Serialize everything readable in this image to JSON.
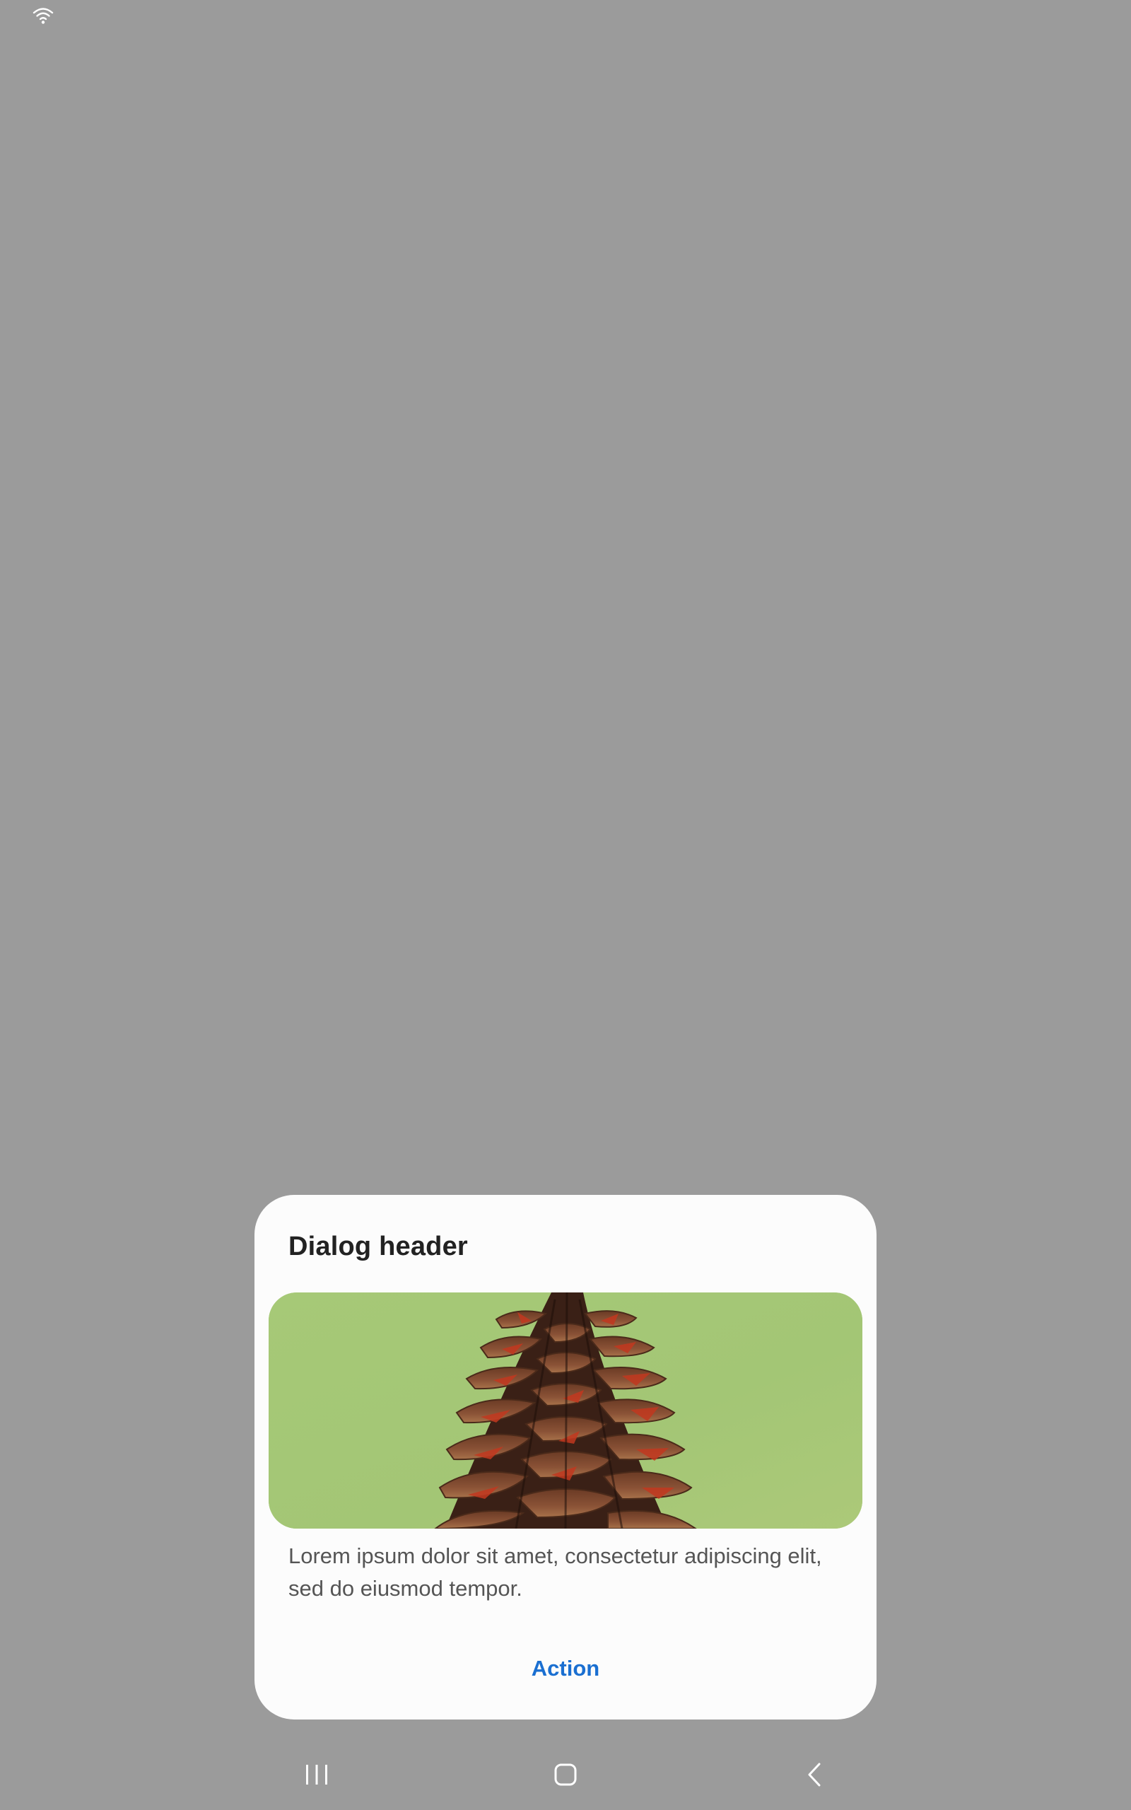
{
  "status_bar": {
    "wifi_icon": "wifi-icon"
  },
  "dialog": {
    "header": "Dialog header",
    "image": {
      "description_icon": "pine-cone-image",
      "background_color": "#a9ca78"
    },
    "body": "Lorem ipsum dolor sit amet, consectetur adipiscing elit, sed do eiusmod tempor.",
    "action_label": "Action",
    "action_color": "#1a6fd1"
  },
  "navigation_bar": {
    "recents_icon": "recents-icon",
    "home_icon": "home-icon",
    "back_icon": "back-icon"
  },
  "colors": {
    "scrim": "#9b9b9b",
    "dialog_background": "#fcfcfc"
  }
}
